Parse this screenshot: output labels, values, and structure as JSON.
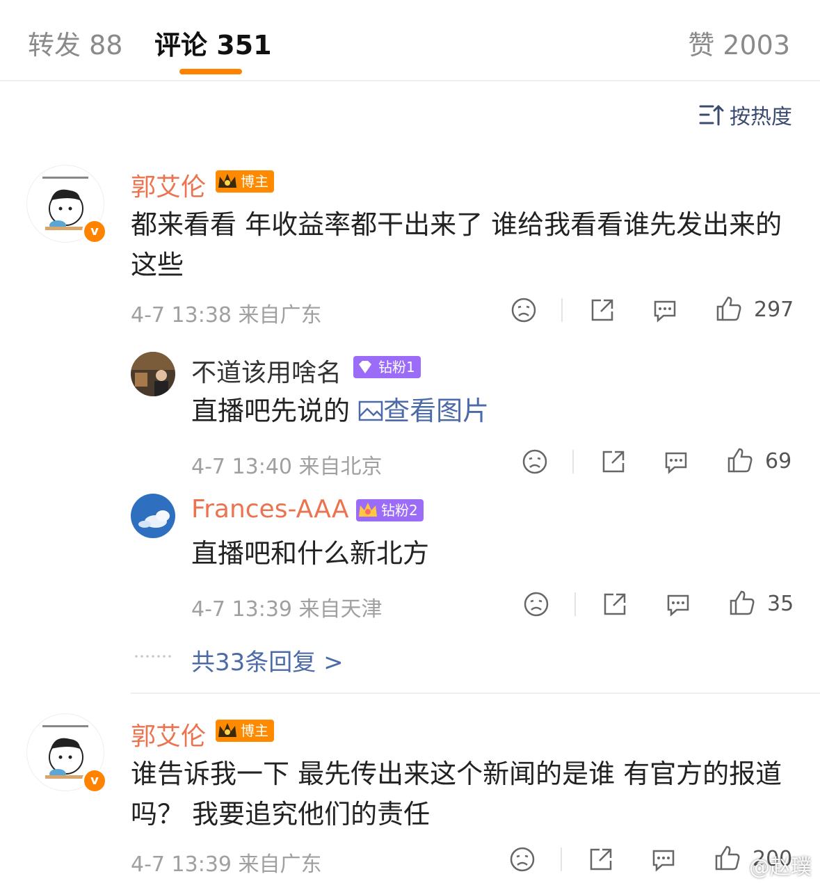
{
  "tabs": {
    "repost": "转发 88",
    "comments": "评论 351",
    "likes": "赞 2003"
  },
  "sort": {
    "label": "按热度"
  },
  "colors": {
    "accent": "#ff8200",
    "username": "#eb7350",
    "link": "#4c6aa8"
  },
  "comments": [
    {
      "author": "郭艾伦",
      "badge": "博主",
      "text": "都来看看 年收益率都干出来了 谁给我看看谁先发出来的这些",
      "time": "4-7 13:38 来自广东",
      "likes": "297",
      "replies": [
        {
          "author": "不道该用啥名",
          "badge": "钻粉1",
          "text": "直播吧先说的",
          "link_text": "查看图片",
          "time": "4-7 13:40 来自北京",
          "likes": "69"
        },
        {
          "author": "Frances-AAA",
          "badge": "钻粉2",
          "text": "直播吧和什么新北方",
          "time": "4-7 13:39 来自天津",
          "likes": "35"
        }
      ],
      "more_replies": "共33条回复 >"
    },
    {
      "author": "郭艾伦",
      "badge": "博主",
      "text": "谁告诉我一下 最先传出来这个新闻的是谁 有官方的报道吗？ 我要追究他们的责任",
      "time": "4-7 13:39 来自广东",
      "likes": "200"
    }
  ],
  "watermark": "@赵璞"
}
